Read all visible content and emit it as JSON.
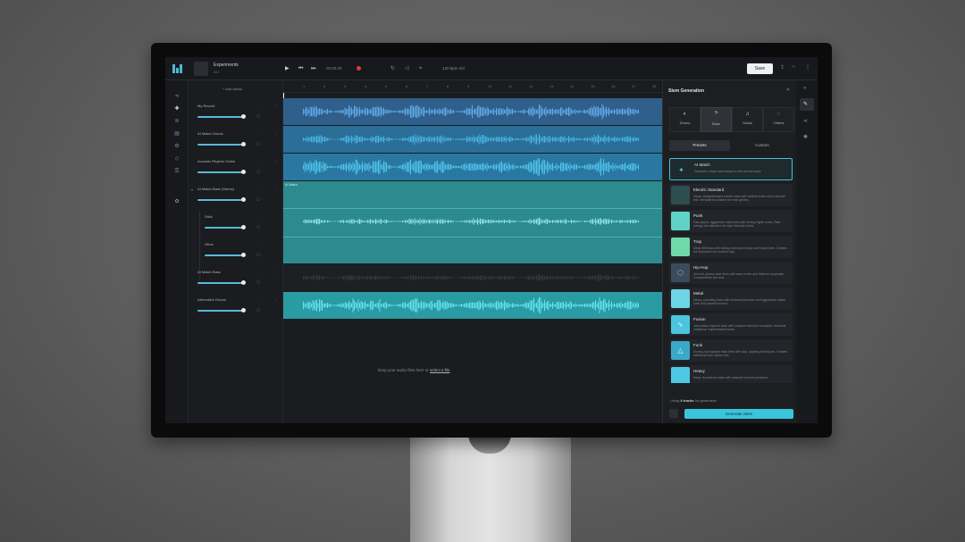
{
  "project": {
    "title": "Experiments",
    "subtitle": "0:0"
  },
  "transport": {
    "time": "00:00.00",
    "bpm_label": "120 bpm  4/4"
  },
  "toolbar": {
    "save_label": "Save"
  },
  "tracks_panel": {
    "add_tracks": "+ Add tracks",
    "tracks": [
      {
        "name": "My Record",
        "volume": 0.9
      },
      {
        "name": "AI Match Drums",
        "volume": 0.9
      },
      {
        "name": "Acoustic Rhythm Guitar",
        "volume": 0.9
      },
      {
        "name": "AI Match Bass (Stems)",
        "volume": 0.9
      },
      {
        "name": "Stick",
        "volume": 0.9
      },
      {
        "name": "Other",
        "volume": 0.9
      },
      {
        "name": "AI Match Bass",
        "volume": 0.9
      },
      {
        "name": "Alternative Drums",
        "volume": 0.9
      }
    ]
  },
  "ruler": [
    "1",
    "2",
    "3",
    "4",
    "5",
    "6",
    "7",
    "8",
    "9",
    "10",
    "11",
    "12",
    "13",
    "14",
    "15",
    "16",
    "17",
    "18"
  ],
  "timeline": {
    "clip_label": "AI Match",
    "drop_text": "Drop your audio files here or ",
    "drop_link": "select a file"
  },
  "right_panel": {
    "title": "Stem Generation",
    "categories": [
      {
        "label": "Drums",
        "icon": "drum-icon"
      },
      {
        "label": "Bass",
        "icon": "bass-icon"
      },
      {
        "label": "Guitar",
        "icon": "guitar-icon"
      },
      {
        "label": "Others",
        "icon": "others-icon"
      }
    ],
    "tabs": [
      "Presets",
      "Custom"
    ],
    "presets": [
      {
        "name": "AI Match",
        "desc": "Generate a bass track based on the current audio",
        "color": "#1d2a2e"
      },
      {
        "name": "Electric Standard",
        "desc": "Clean, straightforward electric bass with defined tones and a smooth feel. Versatile foundation for most genres.",
        "color": "#2e4d4f"
      },
      {
        "name": "Punk",
        "desc": "Fast-paced, aggressive bass lines with driving eighth notes. Raw energy and distortion for high intensity tracks.",
        "color": "#5fd3c6"
      },
      {
        "name": "Trap",
        "desc": "Deep 808 bass with sliding notes and heavy sub frequencies. Creates the foundation for modern trap.",
        "color": "#6fd9a8"
      },
      {
        "name": "Hip-Hop",
        "desc": "Smooth, groovy bass lines with warm tones and rhythmic emphasis. Complements the beat.",
        "color": "#3a4b5c"
      },
      {
        "name": "Metal",
        "desc": "Heavy, pounding bass with technical precision and aggressive attack. Dark and powerful sound.",
        "color": "#6ed3e6"
      },
      {
        "name": "Fusion",
        "desc": "Jazz-fusion inspired bass with complex harmonic concepts, technical variations. Sophisticated tones.",
        "color": "#4cc4e0"
      },
      {
        "name": "Funk",
        "desc": "Groovy, syncopated bass lines with slap, popping techniques. Creates infectious funk rhythm feel.",
        "color": "#3aa9c9"
      },
      {
        "name": "Heavy",
        "desc": "Deep, thunderous bass with massive low end presence.",
        "color": "#4fc8e4"
      }
    ],
    "using_prefix": "Using ",
    "using_bold": "4 tracks",
    "using_suffix": " for generation",
    "generate_label": "Generate Stem"
  },
  "colors": {
    "accent": "#39c6dd",
    "wave_blue": "#4aa8e6",
    "wave_cyan": "#3fd2e6",
    "lane_teal": "#2b8f95"
  }
}
